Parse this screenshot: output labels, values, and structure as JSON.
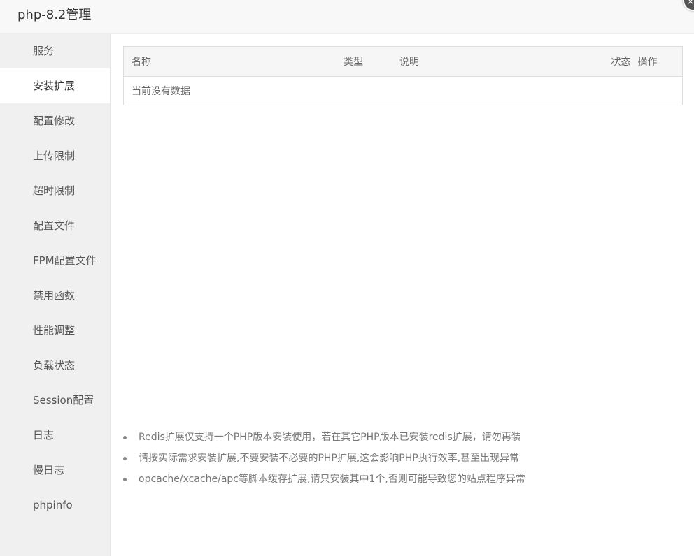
{
  "window": {
    "title": "php-8.2管理",
    "close_icon": "×"
  },
  "sidebar": {
    "items": [
      {
        "label": "服务"
      },
      {
        "label": "安装扩展",
        "active": true
      },
      {
        "label": "配置修改"
      },
      {
        "label": "上传限制"
      },
      {
        "label": "超时限制"
      },
      {
        "label": "配置文件"
      },
      {
        "label": "FPM配置文件"
      },
      {
        "label": "禁用函数"
      },
      {
        "label": "性能调整"
      },
      {
        "label": "负载状态"
      },
      {
        "label": "Session配置"
      },
      {
        "label": "日志"
      },
      {
        "label": "慢日志"
      },
      {
        "label": "phpinfo"
      }
    ]
  },
  "table": {
    "columns": [
      "名称",
      "类型",
      "说明",
      "状态",
      "操作"
    ],
    "empty_text": "当前没有数据"
  },
  "tips": [
    "Redis扩展仅支持一个PHP版本安装使用，若在其它PHP版本已安装redis扩展，请勿再装",
    "请按实际需求安装扩展,不要安装不必要的PHP扩展,这会影响PHP执行效率,甚至出现异常",
    "opcache/xcache/apc等脚本缓存扩展,请只安装其中1个,否则可能导致您的站点程序异常"
  ]
}
